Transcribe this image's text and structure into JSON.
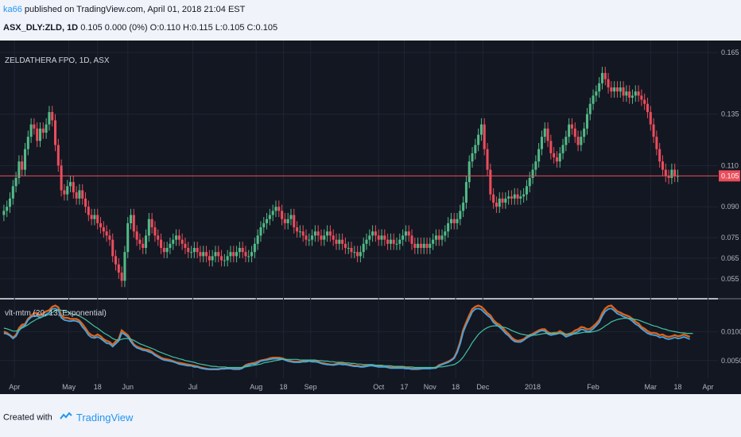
{
  "header": {
    "author": "ka66",
    "published": "published on TradingView.com, April 01, 2018 21:04 EST",
    "symbol": "ASX_DLY:ZLD, 1D",
    "quote": "0.105 0.000 (0%) O:0.110 H:0.115 L:0.105 C:0.105"
  },
  "footer": {
    "created_with": "Created with",
    "brand": "TradingView"
  },
  "colors": {
    "background": "#131722",
    "grid": "#1e2433",
    "up": "#53b987",
    "down": "#eb4d5c",
    "price_line": "#eb4d5c",
    "vlt_orange": "#d9641c",
    "vlt_blue": "#4aa3df",
    "vlt_teal": "#43c3a3",
    "axis_text": "#b2b5be"
  },
  "chart_data": [
    {
      "type": "candlestick",
      "title": "ZELDATHERA FPO, 1D, ASX",
      "ylim": [
        0.048,
        0.17
      ],
      "y_ticks": [
        0.165,
        0.135,
        0.11,
        0.09,
        0.075,
        0.065,
        0.055
      ],
      "y_tick_labels": [
        "0.165",
        "0.135",
        "0.110",
        "0.090",
        "0.075",
        "0.065",
        "0.055"
      ],
      "last_price": 0.105,
      "last_price_label": "0.105",
      "x_labels": [
        "Apr",
        "May",
        "18",
        "Jun",
        "Jul",
        "Aug",
        "18",
        "Sep",
        "Oct",
        "17",
        "Nov",
        "18",
        "Dec",
        "2018",
        "Feb",
        "Mar",
        "18",
        "Apr"
      ],
      "x_label_pos": [
        3.5,
        21.5,
        31,
        41,
        62.5,
        83.5,
        92.5,
        101.5,
        124,
        132.5,
        141,
        149.5,
        158.5,
        175,
        195,
        214,
        223,
        233
      ],
      "close": [
        0.088,
        0.09,
        0.094,
        0.1,
        0.104,
        0.112,
        0.108,
        0.118,
        0.124,
        0.13,
        0.128,
        0.122,
        0.128,
        0.126,
        0.13,
        0.136,
        0.132,
        0.12,
        0.11,
        0.098,
        0.096,
        0.1,
        0.102,
        0.097,
        0.094,
        0.098,
        0.094,
        0.09,
        0.086,
        0.084,
        0.086,
        0.082,
        0.08,
        0.078,
        0.076,
        0.074,
        0.066,
        0.062,
        0.058,
        0.054,
        0.068,
        0.082,
        0.086,
        0.078,
        0.074,
        0.072,
        0.07,
        0.076,
        0.084,
        0.08,
        0.076,
        0.074,
        0.07,
        0.068,
        0.07,
        0.072,
        0.074,
        0.076,
        0.074,
        0.072,
        0.07,
        0.068,
        0.068,
        0.07,
        0.068,
        0.066,
        0.068,
        0.066,
        0.064,
        0.066,
        0.068,
        0.066,
        0.064,
        0.064,
        0.066,
        0.068,
        0.066,
        0.068,
        0.07,
        0.068,
        0.066,
        0.066,
        0.068,
        0.072,
        0.076,
        0.08,
        0.082,
        0.084,
        0.086,
        0.088,
        0.09,
        0.088,
        0.084,
        0.082,
        0.084,
        0.086,
        0.08,
        0.078,
        0.078,
        0.076,
        0.074,
        0.074,
        0.076,
        0.078,
        0.076,
        0.074,
        0.076,
        0.078,
        0.076,
        0.074,
        0.072,
        0.074,
        0.072,
        0.07,
        0.07,
        0.068,
        0.068,
        0.066,
        0.068,
        0.072,
        0.074,
        0.076,
        0.078,
        0.076,
        0.074,
        0.076,
        0.074,
        0.072,
        0.074,
        0.072,
        0.072,
        0.074,
        0.076,
        0.078,
        0.076,
        0.072,
        0.07,
        0.072,
        0.07,
        0.072,
        0.07,
        0.072,
        0.074,
        0.076,
        0.074,
        0.076,
        0.078,
        0.082,
        0.084,
        0.082,
        0.084,
        0.088,
        0.092,
        0.102,
        0.112,
        0.116,
        0.12,
        0.125,
        0.13,
        0.118,
        0.108,
        0.096,
        0.092,
        0.09,
        0.094,
        0.092,
        0.094,
        0.095,
        0.094,
        0.096,
        0.094,
        0.095,
        0.096,
        0.1,
        0.104,
        0.108,
        0.112,
        0.118,
        0.124,
        0.128,
        0.122,
        0.116,
        0.114,
        0.112,
        0.116,
        0.12,
        0.124,
        0.13,
        0.128,
        0.124,
        0.12,
        0.124,
        0.128,
        0.135,
        0.14,
        0.144,
        0.146,
        0.15,
        0.155,
        0.152,
        0.148,
        0.146,
        0.148,
        0.146,
        0.148,
        0.144,
        0.146,
        0.143,
        0.144,
        0.146,
        0.144,
        0.142,
        0.14,
        0.136,
        0.13,
        0.124,
        0.118,
        0.112,
        0.108,
        0.105,
        0.104,
        0.108,
        0.105,
        0.105
      ],
      "x_count": 236
    },
    {
      "type": "line",
      "title": "vlt-mtm (20, 13, Exponential)",
      "ylim": [
        0.0025,
        0.015
      ],
      "y_ticks": [
        0.01,
        0.005
      ],
      "y_tick_labels": [
        "0.0100",
        "0.0050"
      ],
      "series": [
        {
          "key": "orange",
          "values": [
            0.01,
            0.0098,
            0.0094,
            0.009,
            0.0094,
            0.0106,
            0.0112,
            0.0113,
            0.0122,
            0.0127,
            0.0132,
            0.0132,
            0.0128,
            0.0132,
            0.0135,
            0.0137,
            0.0143,
            0.0145,
            0.0142,
            0.0128,
            0.0124,
            0.0124,
            0.0122,
            0.0122,
            0.0122,
            0.0119,
            0.0113,
            0.0106,
            0.0098,
            0.0094,
            0.0092,
            0.0095,
            0.0092,
            0.0087,
            0.0084,
            0.0082,
            0.0077,
            0.0083,
            0.0087,
            0.0102,
            0.0098,
            0.0094,
            0.0086,
            0.0078,
            0.0074,
            0.0072,
            0.007,
            0.0069,
            0.0068,
            0.0065,
            0.0061,
            0.0058,
            0.0055,
            0.0053,
            0.0052,
            0.0051,
            0.0049,
            0.0047,
            0.0046,
            0.0045,
            0.0044,
            0.0043,
            0.0042,
            0.0041,
            0.004,
            0.0038,
            0.0037,
            0.0036,
            0.0035,
            0.0035,
            0.0035,
            0.0035,
            0.0036,
            0.0036,
            0.0037,
            0.0037,
            0.0036,
            0.0036,
            0.0036,
            0.0038,
            0.0042,
            0.0044,
            0.0045,
            0.0046,
            0.0048,
            0.005,
            0.0051,
            0.0052,
            0.0054,
            0.0055,
            0.0055,
            0.0055,
            0.0054,
            0.0052,
            0.005,
            0.0049,
            0.0048,
            0.0048,
            0.0048,
            0.0049,
            0.005,
            0.005,
            0.0049,
            0.0049,
            0.0048,
            0.0046,
            0.0045,
            0.0044,
            0.0043,
            0.0043,
            0.0044,
            0.0045,
            0.0045,
            0.0044,
            0.0043,
            0.0042,
            0.0041,
            0.0041,
            0.004,
            0.004,
            0.0041,
            0.0042,
            0.0042,
            0.0041,
            0.004,
            0.004,
            0.004,
            0.0039,
            0.0038,
            0.0038,
            0.0038,
            0.0038,
            0.0038,
            0.0038,
            0.0037,
            0.0036,
            0.0036,
            0.0036,
            0.0036,
            0.0037,
            0.0037,
            0.0037,
            0.0037,
            0.0038,
            0.0042,
            0.0044,
            0.0046,
            0.0048,
            0.0051,
            0.0055,
            0.0066,
            0.0082,
            0.0103,
            0.0116,
            0.0128,
            0.0139,
            0.0143,
            0.0145,
            0.0143,
            0.0138,
            0.0132,
            0.0128,
            0.012,
            0.0115,
            0.0112,
            0.0107,
            0.0101,
            0.0096,
            0.009,
            0.0086,
            0.0084,
            0.0085,
            0.0087,
            0.0091,
            0.0094,
            0.0096,
            0.0099,
            0.0102,
            0.0104,
            0.0104,
            0.0099,
            0.0097,
            0.0098,
            0.0098,
            0.0101,
            0.0098,
            0.0094,
            0.0096,
            0.0098,
            0.0102,
            0.0104,
            0.0108,
            0.0107,
            0.0104,
            0.0105,
            0.0109,
            0.0114,
            0.012,
            0.0132,
            0.014,
            0.0144,
            0.0145,
            0.014,
            0.0135,
            0.0133,
            0.013,
            0.0128,
            0.0126,
            0.0122,
            0.0117,
            0.0114,
            0.0108,
            0.0105,
            0.0101,
            0.0098,
            0.0098,
            0.0097,
            0.0094,
            0.0095,
            0.0092,
            0.0091,
            0.0092,
            0.0094,
            0.0092,
            0.0093,
            0.0095,
            0.0093,
            0.0091
          ]
        },
        {
          "key": "blue",
          "values": [
            0.0097,
            0.0096,
            0.0093,
            0.0088,
            0.0092,
            0.0102,
            0.0108,
            0.0111,
            0.012,
            0.0125,
            0.0127,
            0.0127,
            0.0124,
            0.0127,
            0.013,
            0.0133,
            0.0139,
            0.014,
            0.0137,
            0.0124,
            0.012,
            0.0119,
            0.0118,
            0.0119,
            0.0118,
            0.0116,
            0.0108,
            0.0102,
            0.0094,
            0.009,
            0.0089,
            0.0091,
            0.0088,
            0.0084,
            0.008,
            0.0079,
            0.0074,
            0.0079,
            0.0084,
            0.0098,
            0.0095,
            0.0091,
            0.0083,
            0.0076,
            0.0072,
            0.007,
            0.0068,
            0.0067,
            0.0065,
            0.0063,
            0.0059,
            0.0056,
            0.0053,
            0.0051,
            0.005,
            0.0049,
            0.0048,
            0.0046,
            0.0044,
            0.0043,
            0.0042,
            0.0041,
            0.0041,
            0.0039,
            0.0039,
            0.0037,
            0.0036,
            0.0035,
            0.0035,
            0.0035,
            0.0035,
            0.0035,
            0.0036,
            0.0036,
            0.0036,
            0.0036,
            0.0035,
            0.0035,
            0.0035,
            0.0037,
            0.0041,
            0.0042,
            0.0044,
            0.0044,
            0.0046,
            0.0049,
            0.005,
            0.0051,
            0.0052,
            0.0053,
            0.0053,
            0.0053,
            0.0053,
            0.0051,
            0.0049,
            0.0048,
            0.0047,
            0.0047,
            0.0047,
            0.0048,
            0.0048,
            0.0049,
            0.0048,
            0.0048,
            0.0047,
            0.0045,
            0.0044,
            0.0043,
            0.0043,
            0.0042,
            0.0043,
            0.0044,
            0.0043,
            0.0043,
            0.0042,
            0.0041,
            0.004,
            0.004,
            0.0039,
            0.0039,
            0.004,
            0.0041,
            0.0041,
            0.004,
            0.0039,
            0.0039,
            0.0039,
            0.0038,
            0.0037,
            0.0037,
            0.0037,
            0.0037,
            0.0037,
            0.0036,
            0.0036,
            0.0035,
            0.0035,
            0.0035,
            0.0036,
            0.0036,
            0.0036,
            0.0036,
            0.0037,
            0.0037,
            0.0041,
            0.0043,
            0.0045,
            0.0047,
            0.005,
            0.0054,
            0.0064,
            0.0079,
            0.0099,
            0.0112,
            0.0123,
            0.0134,
            0.0139,
            0.014,
            0.0138,
            0.0133,
            0.0128,
            0.0124,
            0.0116,
            0.0112,
            0.0108,
            0.0103,
            0.0097,
            0.0093,
            0.0087,
            0.0083,
            0.0082,
            0.0082,
            0.0085,
            0.0089,
            0.0092,
            0.0094,
            0.0097,
            0.01,
            0.0102,
            0.0101,
            0.0096,
            0.0094,
            0.0095,
            0.0096,
            0.0098,
            0.0095,
            0.0091,
            0.0093,
            0.0095,
            0.0098,
            0.01,
            0.0104,
            0.0103,
            0.01,
            0.0101,
            0.0105,
            0.011,
            0.0116,
            0.0127,
            0.0135,
            0.0139,
            0.014,
            0.0136,
            0.0131,
            0.0129,
            0.0126,
            0.0124,
            0.0122,
            0.0118,
            0.0113,
            0.011,
            0.0105,
            0.0101,
            0.0097,
            0.0095,
            0.0094,
            0.0093,
            0.009,
            0.0091,
            0.0088,
            0.0087,
            0.0088,
            0.009,
            0.0088,
            0.0089,
            0.0091,
            0.0089,
            0.0087
          ]
        },
        {
          "key": "teal",
          "values": [
            0.0106,
            0.0105,
            0.0103,
            0.0101,
            0.0101,
            0.0103,
            0.0106,
            0.0109,
            0.0112,
            0.0116,
            0.0119,
            0.0122,
            0.0124,
            0.0126,
            0.0128,
            0.013,
            0.0133,
            0.0136,
            0.0138,
            0.0137,
            0.0136,
            0.0134,
            0.0132,
            0.013,
            0.0129,
            0.0127,
            0.0124,
            0.0121,
            0.0117,
            0.0113,
            0.0109,
            0.0106,
            0.0102,
            0.0098,
            0.0095,
            0.0092,
            0.0088,
            0.0086,
            0.0085,
            0.0087,
            0.0088,
            0.0088,
            0.0087,
            0.0085,
            0.0082,
            0.0079,
            0.0077,
            0.0075,
            0.0073,
            0.0071,
            0.0069,
            0.0066,
            0.0064,
            0.0062,
            0.006,
            0.0058,
            0.0056,
            0.0055,
            0.0053,
            0.0052,
            0.005,
            0.0049,
            0.0048,
            0.0047,
            0.0045,
            0.0044,
            0.0043,
            0.0042,
            0.0041,
            0.004,
            0.004,
            0.0039,
            0.0039,
            0.0039,
            0.0038,
            0.0038,
            0.0038,
            0.0038,
            0.0038,
            0.0038,
            0.0039,
            0.004,
            0.0041,
            0.0042,
            0.0043,
            0.0044,
            0.0046,
            0.0047,
            0.0048,
            0.0049,
            0.005,
            0.0051,
            0.0052,
            0.0052,
            0.0052,
            0.0052,
            0.0052,
            0.0052,
            0.0051,
            0.0051,
            0.0051,
            0.0051,
            0.0051,
            0.0051,
            0.005,
            0.005,
            0.0049,
            0.0049,
            0.0048,
            0.0048,
            0.0047,
            0.0047,
            0.0047,
            0.0046,
            0.0046,
            0.0045,
            0.0045,
            0.0044,
            0.0044,
            0.0043,
            0.0043,
            0.0043,
            0.0043,
            0.0042,
            0.0042,
            0.0042,
            0.0041,
            0.0041,
            0.0041,
            0.004,
            0.004,
            0.004,
            0.004,
            0.0039,
            0.0039,
            0.0039,
            0.0038,
            0.0038,
            0.0038,
            0.0038,
            0.0038,
            0.0038,
            0.0038,
            0.0038,
            0.0039,
            0.0039,
            0.004,
            0.0041,
            0.0042,
            0.0043,
            0.0046,
            0.005,
            0.0056,
            0.0064,
            0.0072,
            0.0081,
            0.0088,
            0.0095,
            0.01,
            0.0104,
            0.0107,
            0.0109,
            0.011,
            0.011,
            0.0109,
            0.0108,
            0.0107,
            0.0105,
            0.0102,
            0.01,
            0.0098,
            0.0096,
            0.0095,
            0.0094,
            0.0094,
            0.0094,
            0.0094,
            0.0095,
            0.0096,
            0.0097,
            0.0097,
            0.0097,
            0.0097,
            0.0097,
            0.0097,
            0.0097,
            0.0096,
            0.0096,
            0.0096,
            0.0096,
            0.0097,
            0.0098,
            0.0099,
            0.0099,
            0.0099,
            0.01,
            0.0101,
            0.0103,
            0.0106,
            0.011,
            0.0113,
            0.0117,
            0.0119,
            0.0121,
            0.0122,
            0.0123,
            0.0123,
            0.0123,
            0.0122,
            0.0121,
            0.012,
            0.0118,
            0.0116,
            0.0114,
            0.0112,
            0.011,
            0.0109,
            0.0107,
            0.0105,
            0.0104,
            0.0102,
            0.0101,
            0.01,
            0.0099,
            0.0098,
            0.0098,
            0.0097,
            0.0097,
            0.0097
          ]
        }
      ]
    }
  ]
}
